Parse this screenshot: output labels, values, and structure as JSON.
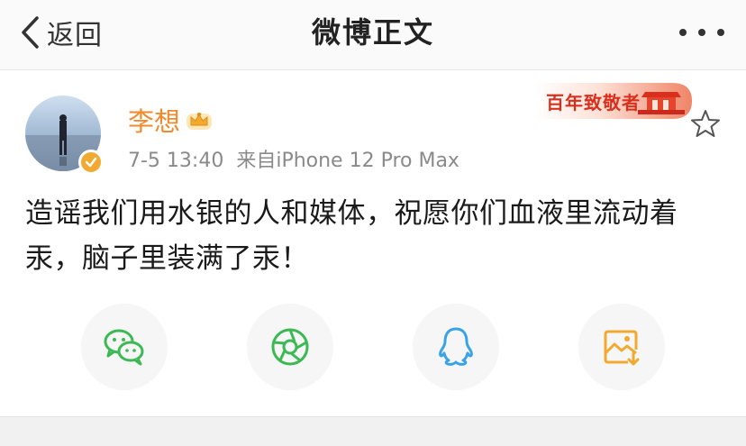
{
  "nav": {
    "back_label": "返回",
    "title": "微博正文"
  },
  "post": {
    "author": "李想",
    "date": "7-5 13:40",
    "source": "来自iPhone 12 Pro Max",
    "badge_text": "百年致敬者",
    "text": "造谣我们用水银的人和媒体，祝愿你们血液里流动着汞，脑子里装满了汞！"
  },
  "share": {
    "items": [
      {
        "icon": "wechat-icon",
        "color": "#3cb954"
      },
      {
        "icon": "moments-icon",
        "color": "#3cb954"
      },
      {
        "icon": "qq-icon",
        "color": "#3aa3e8"
      },
      {
        "icon": "save-image-icon",
        "color": "#f2a930"
      }
    ]
  },
  "colors": {
    "username": "#f08a2c",
    "meta": "#8a8a8a",
    "badge_red": "#d9301e",
    "verified": "#f2a930"
  }
}
